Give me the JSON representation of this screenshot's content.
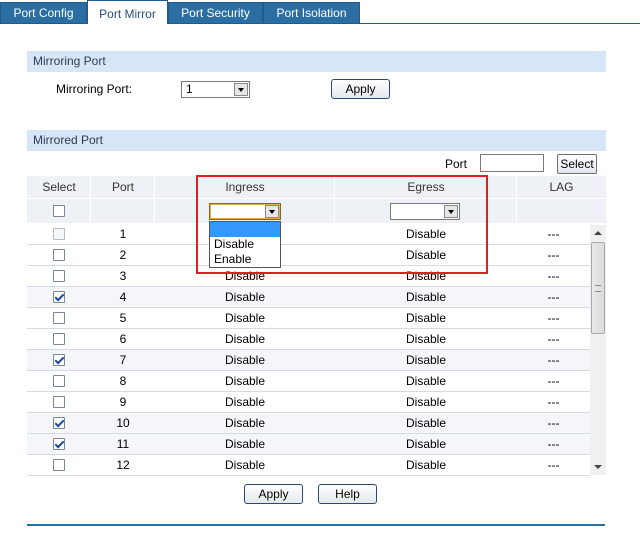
{
  "tabs": [
    {
      "label": "Port Config",
      "active": false
    },
    {
      "label": "Port Mirror",
      "active": true
    },
    {
      "label": "Port Security",
      "active": false
    },
    {
      "label": "Port Isolation",
      "active": false
    }
  ],
  "mirroring": {
    "header": "Mirroring Port",
    "label": "Mirroring Port:",
    "value": "1",
    "apply_label": "Apply"
  },
  "mirrored": {
    "header": "Mirrored Port",
    "port_label": "Port",
    "port_value": "",
    "select_label": "Select",
    "columns": {
      "select": "Select",
      "port": "Port",
      "ingress": "Ingress",
      "egress": "Egress",
      "lag": "LAG"
    },
    "ingress_filter_value": "",
    "egress_filter_value": "",
    "ingress_options": [
      "",
      "Disable",
      "Enable"
    ],
    "rows": [
      {
        "port": "1",
        "checked": false,
        "ingress": "Disable",
        "egress": "Disable",
        "lag": "---",
        "disabled": true
      },
      {
        "port": "2",
        "checked": false,
        "ingress": "Disable",
        "egress": "Disable",
        "lag": "---",
        "disabled": false
      },
      {
        "port": "3",
        "checked": false,
        "ingress": "Disable",
        "egress": "Disable",
        "lag": "---",
        "disabled": false
      },
      {
        "port": "4",
        "checked": true,
        "ingress": "Disable",
        "egress": "Disable",
        "lag": "---",
        "disabled": false
      },
      {
        "port": "5",
        "checked": false,
        "ingress": "Disable",
        "egress": "Disable",
        "lag": "---",
        "disabled": false
      },
      {
        "port": "6",
        "checked": false,
        "ingress": "Disable",
        "egress": "Disable",
        "lag": "---",
        "disabled": false
      },
      {
        "port": "7",
        "checked": true,
        "ingress": "Disable",
        "egress": "Disable",
        "lag": "---",
        "disabled": false
      },
      {
        "port": "8",
        "checked": false,
        "ingress": "Disable",
        "egress": "Disable",
        "lag": "---",
        "disabled": false
      },
      {
        "port": "9",
        "checked": false,
        "ingress": "Disable",
        "egress": "Disable",
        "lag": "---",
        "disabled": false
      },
      {
        "port": "10",
        "checked": true,
        "ingress": "Disable",
        "egress": "Disable",
        "lag": "---",
        "disabled": false
      },
      {
        "port": "11",
        "checked": true,
        "ingress": "Disable",
        "egress": "Disable",
        "lag": "---",
        "disabled": false
      },
      {
        "port": "12",
        "checked": false,
        "ingress": "Disable",
        "egress": "Disable",
        "lag": "---",
        "disabled": false
      }
    ]
  },
  "footer": {
    "apply_label": "Apply",
    "help_label": "Help"
  },
  "colors": {
    "tab_blue": "#2b6ea3",
    "header_bg": "#d6e6f7",
    "highlight_red": "#e02020",
    "selection_blue": "#3399ff"
  }
}
